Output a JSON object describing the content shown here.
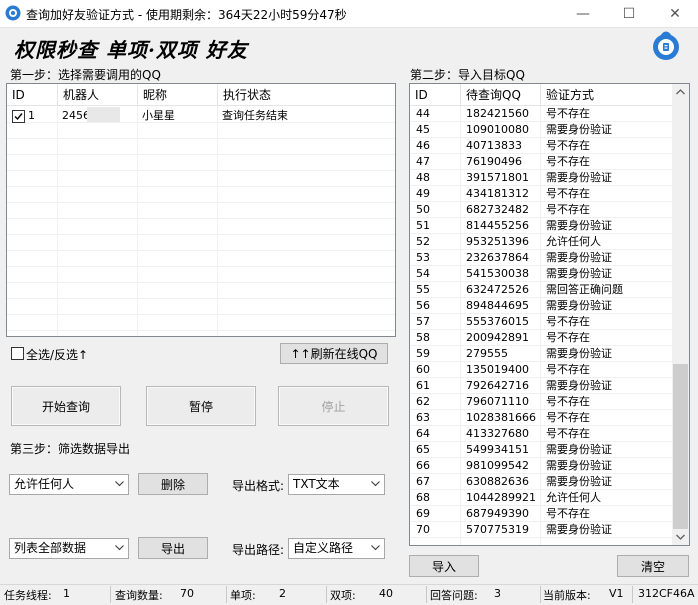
{
  "window": {
    "title": "查询加好友验证方式 - 使用期剩余：364天22小时59分47秒",
    "minimize_glyph": "—",
    "maximize_glyph": "☐",
    "close_glyph": "✕"
  },
  "banner": {
    "text": "权限秒查 单项·双项 好友"
  },
  "step1": {
    "label": "第一步：选择需要调用的QQ",
    "columns": [
      "ID",
      "机器人",
      "昵称",
      "执行状态"
    ],
    "rows": [
      {
        "id": "1",
        "robot": "2456",
        "nickname": "小星星",
        "status": "查询任务结束",
        "checked": true
      }
    ],
    "select_all_label": "全选/反选↑",
    "refresh_label": "↑↑刷新在线QQ",
    "start_label": "开始查询",
    "pause_label": "暂停",
    "stop_label": "停止"
  },
  "step2": {
    "label": "第二步：导入目标QQ",
    "columns": [
      "ID",
      "待查询QQ",
      "验证方式"
    ],
    "rows": [
      {
        "id": "44",
        "qq": "182421560",
        "mode": "号不存在"
      },
      {
        "id": "45",
        "qq": "109010080",
        "mode": "需要身份验证"
      },
      {
        "id": "46",
        "qq": "40713833",
        "mode": "号不存在"
      },
      {
        "id": "47",
        "qq": "76190496",
        "mode": "号不存在"
      },
      {
        "id": "48",
        "qq": "391571801",
        "mode": "需要身份验证"
      },
      {
        "id": "49",
        "qq": "434181312",
        "mode": "号不存在"
      },
      {
        "id": "50",
        "qq": "682732482",
        "mode": "号不存在"
      },
      {
        "id": "51",
        "qq": "814455256",
        "mode": "需要身份验证"
      },
      {
        "id": "52",
        "qq": "953251396",
        "mode": "允许任何人"
      },
      {
        "id": "53",
        "qq": "232637864",
        "mode": "需要身份验证"
      },
      {
        "id": "54",
        "qq": "541530038",
        "mode": "需要身份验证"
      },
      {
        "id": "55",
        "qq": "632472526",
        "mode": "需回答正确问题"
      },
      {
        "id": "56",
        "qq": "894844695",
        "mode": "需要身份验证"
      },
      {
        "id": "57",
        "qq": "555376015",
        "mode": "号不存在"
      },
      {
        "id": "58",
        "qq": "200942891",
        "mode": "号不存在"
      },
      {
        "id": "59",
        "qq": "279555",
        "mode": "需要身份验证"
      },
      {
        "id": "60",
        "qq": "135019400",
        "mode": "号不存在"
      },
      {
        "id": "61",
        "qq": "792642716",
        "mode": "需要身份验证"
      },
      {
        "id": "62",
        "qq": "796071110",
        "mode": "号不存在"
      },
      {
        "id": "63",
        "qq": "1028381666",
        "mode": "号不存在"
      },
      {
        "id": "64",
        "qq": "413327680",
        "mode": "号不存在"
      },
      {
        "id": "65",
        "qq": "549934151",
        "mode": "需要身份验证"
      },
      {
        "id": "66",
        "qq": "981099542",
        "mode": "需要身份验证"
      },
      {
        "id": "67",
        "qq": "630882636",
        "mode": "需要身份验证"
      },
      {
        "id": "68",
        "qq": "1044289921",
        "mode": "允许任何人"
      },
      {
        "id": "69",
        "qq": "687949390",
        "mode": "号不存在"
      },
      {
        "id": "70",
        "qq": "570775319",
        "mode": "需要身份验证"
      }
    ],
    "import_label": "导入",
    "clear_label": "清空"
  },
  "step3": {
    "label": "第三步：筛选数据导出",
    "filter_value": "允许任何人",
    "delete_label": "删除",
    "format_label": "导出格式:",
    "format_value": "TXT文本",
    "scope_value": "列表全部数据",
    "export_label": "导出",
    "path_label": "导出路径:",
    "path_value": "自定义路径"
  },
  "status": {
    "threads_label": "任务线程:",
    "threads_value": "1",
    "count_label": "查询数量:",
    "count_value": "70",
    "single_label": "单项:",
    "single_value": "2",
    "double_label": "双项:",
    "double_value": "40",
    "question_label": "回答问题:",
    "question_value": "3",
    "version_label": "当前版本:",
    "version_value": "V1",
    "code_value": "312CF46A"
  },
  "colors": {
    "accent_blue": "#2a7bd4",
    "selection_border": "#828790"
  }
}
